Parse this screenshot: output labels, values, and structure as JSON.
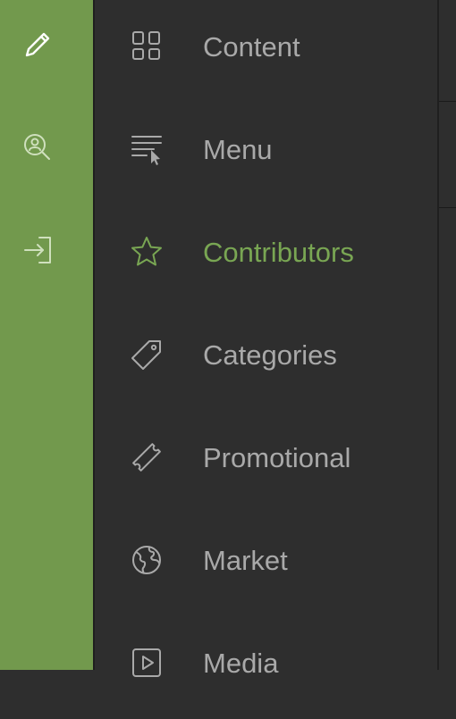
{
  "rail": {
    "buttons": [
      {
        "icon": "pencil-icon"
      },
      {
        "icon": "user-search-icon"
      },
      {
        "icon": "sign-in-icon"
      }
    ]
  },
  "menu": {
    "items": [
      {
        "label": "Content",
        "icon": "grid-icon",
        "active": false
      },
      {
        "label": "Menu",
        "icon": "menu-cursor-icon",
        "active": false
      },
      {
        "label": "Contributors",
        "icon": "star-icon",
        "active": true
      },
      {
        "label": "Categories",
        "icon": "tag-icon",
        "active": false
      },
      {
        "label": "Promotional",
        "icon": "ticket-icon",
        "active": false
      },
      {
        "label": "Market",
        "icon": "globe-icon",
        "active": false
      },
      {
        "label": "Media",
        "icon": "play-icon",
        "active": false
      }
    ]
  },
  "colors": {
    "rail_bg": "#72994d",
    "panel_bg": "#2e2e2e",
    "text": "#a9a9a9",
    "active": "#79a653"
  }
}
